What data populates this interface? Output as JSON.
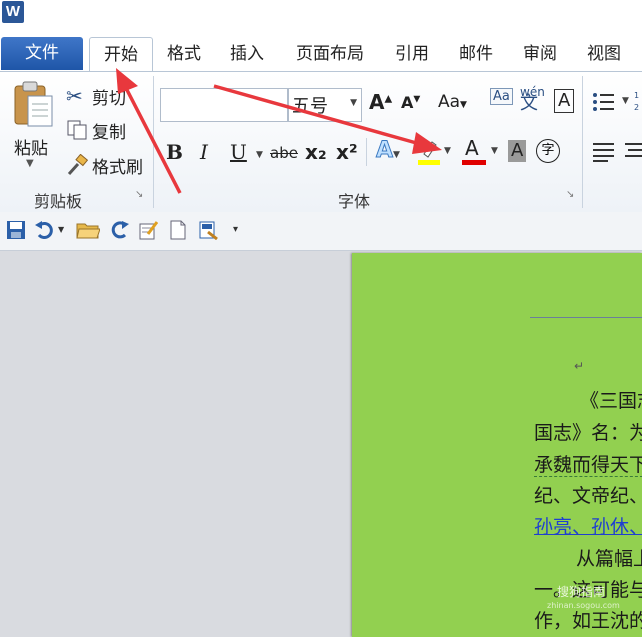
{
  "app": {
    "logo_letter": "W"
  },
  "tabs": {
    "file": "文件",
    "home": "开始",
    "items": [
      "格式",
      "插入",
      "页面布局",
      "引用",
      "邮件",
      "审阅",
      "视图"
    ]
  },
  "clipboard": {
    "paste": "粘贴",
    "cut": "剪切",
    "copy": "复制",
    "format_painter": "格式刷",
    "group_label": "剪贴板"
  },
  "font": {
    "font_name_value": "",
    "font_size_value": "五号",
    "group_label": "字体",
    "bold": "B",
    "italic": "I",
    "underline": "U",
    "strikethrough": "abe",
    "subscript": "x₂",
    "superscript": "x²",
    "change_case": "Aa",
    "clear_format": "Aa",
    "phonetic": "wén",
    "phonetic_char": "文",
    "border_char": "A",
    "grow": "A",
    "shrink": "A",
    "text_effect": "A",
    "font_color": "A",
    "shading": "A",
    "enclose": "字",
    "highlight_color": "#ffff00",
    "font_color_value": "#e00000"
  },
  "document": {
    "page_color": "#92d050",
    "para_mark": "↵",
    "lines": [
      {
        "text": "《三国志"
      },
      {
        "text": "国志》名：为"
      },
      {
        "text": "承魏而得天下"
      },
      {
        "text": "纪、文帝纪、"
      },
      {
        "text": "孙亮、孙休、"
      },
      {
        "text": "从篇幅上"
      },
      {
        "text": "一。这可能与"
      },
      {
        "text": "作，如王沈的"
      }
    ],
    "watermark": "搜狗指南",
    "watermark_sub": "zhinan.sogou.com"
  },
  "colors": {
    "accent": "#2b5797",
    "arrow": "#e8383d"
  }
}
